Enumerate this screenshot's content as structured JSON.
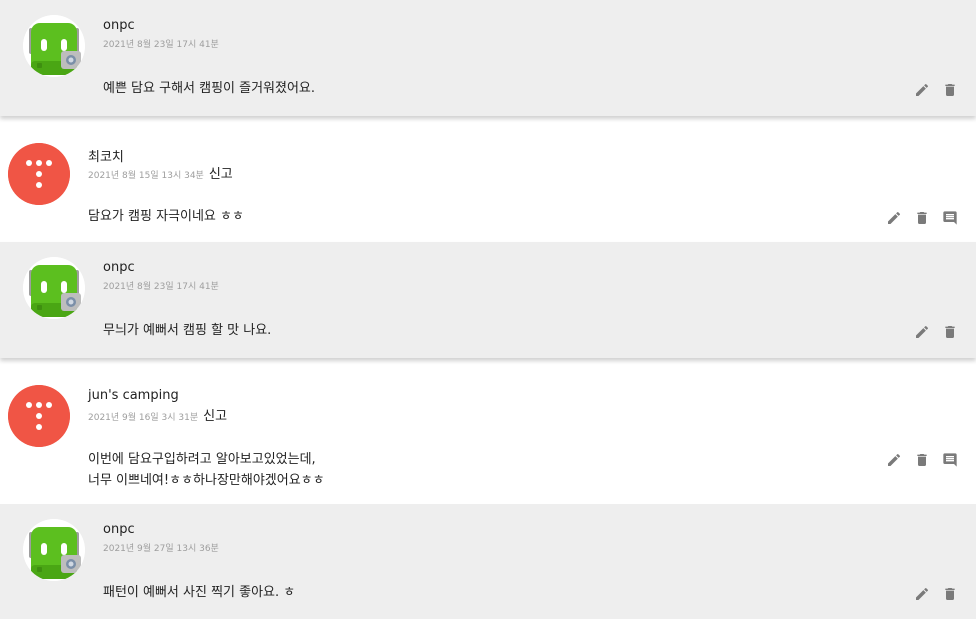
{
  "comments": [
    {
      "kind": "reply",
      "author": "onpc",
      "date": "2021년 8월 23일 17시 41분",
      "lines": [
        "예쁜 담요 구해서 캠핑이 즐거워졌어요."
      ],
      "actions": [
        "edit-icon",
        "delete-icon"
      ]
    },
    {
      "kind": "comment",
      "author": "최코치",
      "date": "2021년 8월 15일 13시 34분",
      "report_label": "신고",
      "lines": [
        "담요가 캠핑 자극이네요 ㅎㅎ"
      ],
      "actions": [
        "edit-icon",
        "delete-icon",
        "comment-icon"
      ]
    },
    {
      "kind": "reply",
      "author": "onpc",
      "date": "2021년 8월 23일 17시 41분",
      "lines": [
        "무늬가 예뻐서 캠핑 할 맛 나요."
      ],
      "actions": [
        "edit-icon",
        "delete-icon"
      ]
    },
    {
      "kind": "comment",
      "author": "jun's camping",
      "date": "2021년 9월 16일 3시 31분",
      "report_label": "신고",
      "lines": [
        "이번에 담요구입하려고 알아보고있었는데,",
        "너무 이쁘네여!ㅎㅎ하나장만해야겠어요ㅎㅎ"
      ],
      "actions": [
        "edit-icon",
        "delete-icon",
        "comment-icon"
      ]
    },
    {
      "kind": "reply",
      "author": "onpc",
      "date": "2021년 9월 27일 13시 36분",
      "lines": [
        "패턴이 예뻐서 사진 찍기 좋아요. ㅎ"
      ],
      "actions": [
        "edit-icon",
        "delete-icon"
      ]
    }
  ],
  "colors": {
    "reply_bg": "#eeeeee",
    "avatar_red": "#f05545",
    "avatar_green": "#5cbf1f",
    "icon_gray": "#7a7a7a"
  }
}
